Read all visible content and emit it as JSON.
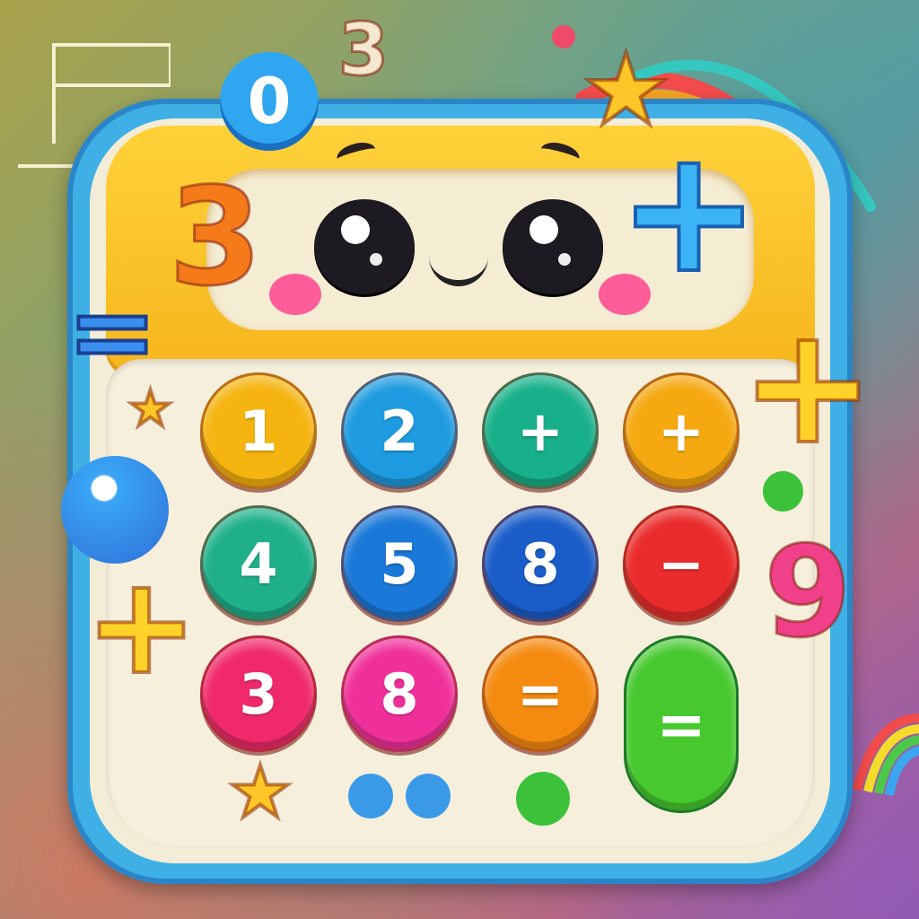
{
  "keypad": {
    "buttons": [
      {
        "label": "1",
        "color": "#f5b410"
      },
      {
        "label": "2",
        "color": "#1e9be0"
      },
      {
        "label": "+",
        "color": "#18b08a"
      },
      {
        "label": "+",
        "color": "#f5a810"
      },
      {
        "label": "4",
        "color": "#1fb08a"
      },
      {
        "label": "5",
        "color": "#1a78d8"
      },
      {
        "label": "8",
        "color": "#1a5cc8"
      },
      {
        "label": "−",
        "color": "#ea2b2b"
      },
      {
        "label": "3",
        "color": "#f02a6a"
      },
      {
        "label": "8",
        "color": "#f0309a"
      },
      {
        "label": "=",
        "color": "#f58a10"
      }
    ],
    "equals_label": "="
  },
  "decorations": {
    "digit_0": "0",
    "digit_3_top": "3",
    "digit_3_left": "3",
    "digit_9": "9",
    "plus": "+",
    "equals": "=",
    "star": "★"
  }
}
